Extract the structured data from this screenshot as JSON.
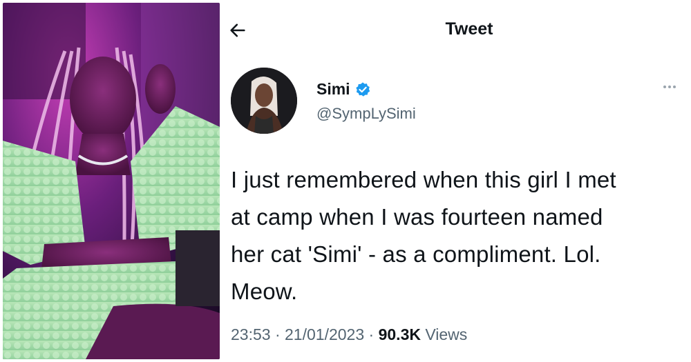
{
  "header": {
    "title": "Tweet"
  },
  "author": {
    "display_name": "Simi",
    "handle": "@SympLySimi",
    "verified": true
  },
  "tweet": {
    "lines": [
      "I just remembered when this girl I met",
      "at camp when I was fourteen named",
      "her cat 'Simi' - as a compliment. Lol.",
      "Meow."
    ]
  },
  "meta": {
    "time": "23:53",
    "separator": "·",
    "date": "21/01/2023",
    "views_count": "90.3K",
    "views_label": "Views"
  },
  "colors": {
    "verified": "#1d9bf0",
    "secondary_text": "#536471",
    "primary_text": "#0f1419"
  },
  "icons": {
    "back": "arrow-left-icon",
    "verified": "verified-badge-icon",
    "more": "more-horizontal-icon"
  }
}
